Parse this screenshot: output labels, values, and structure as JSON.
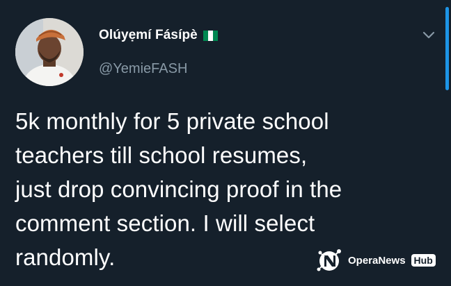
{
  "tweet": {
    "display_name": "Olúyẹmí Fásípè",
    "handle": "@YemieFASH",
    "text": "5k monthly for 5 private school\nteachers till school resumes,\njust drop convincing proof in the\ncomment section. I will select\nrandomly."
  },
  "watermark": {
    "brand": "OperaNews",
    "badge": "Hub"
  },
  "icons": {
    "flag": "nigeria-flag-icon",
    "more": "chevron-down-icon",
    "logo": "operanews-logo-icon"
  },
  "colors": {
    "background": "#15202b",
    "secondary_text": "#8899a6",
    "accent": "#1d9bf0",
    "flag_green": "#008751"
  }
}
